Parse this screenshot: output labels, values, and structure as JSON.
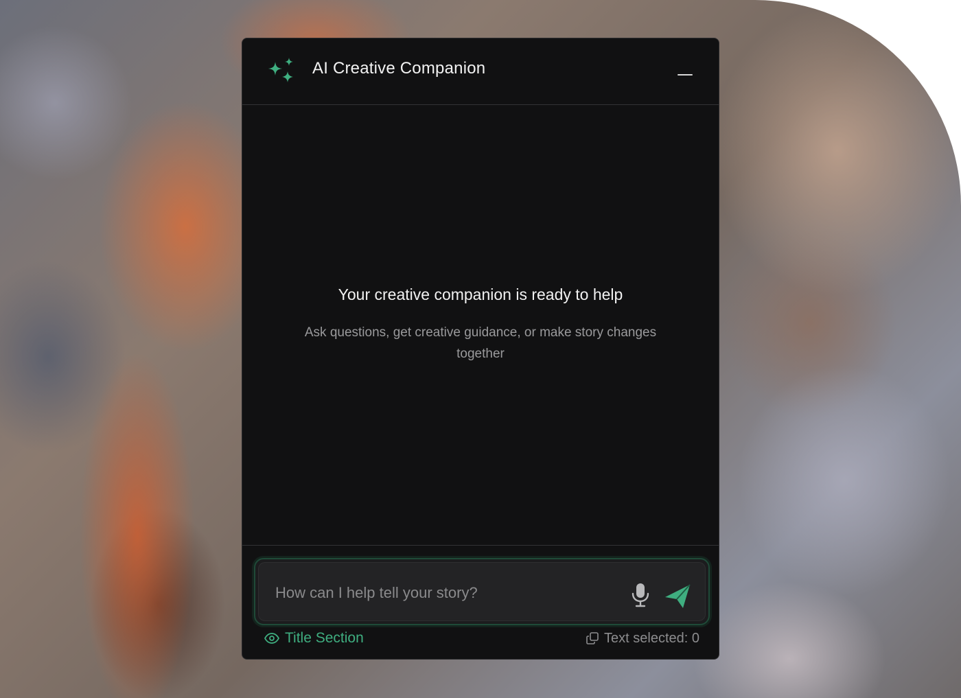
{
  "app": {
    "title": "AI Creative Companion",
    "accent_color": "#3fae80",
    "icons": {
      "logo": "sparkles-icon",
      "minimize": "minimize-icon",
      "mic": "microphone-icon",
      "send": "send-icon",
      "section": "eye-icon",
      "selection": "copy-icon"
    }
  },
  "empty_state": {
    "title": "Your creative companion is ready to help",
    "subtitle": "Ask questions, get creative guidance, or make story changes together"
  },
  "composer": {
    "placeholder": "How can I help tell your story?",
    "value": ""
  },
  "status_bar": {
    "section_label": "Title Section",
    "selection_label": "Text selected: 0"
  }
}
